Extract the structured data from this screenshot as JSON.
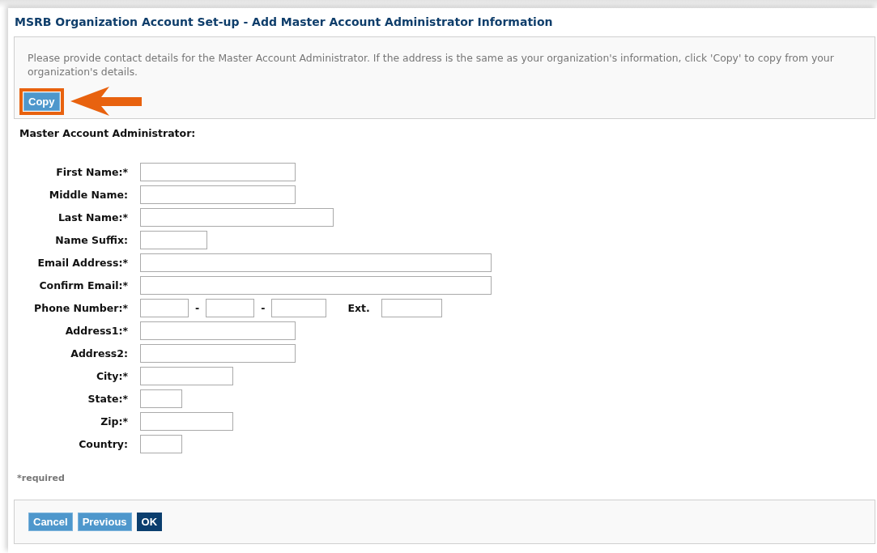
{
  "title": "MSRB Organization Account Set-up - Add Master Account Administrator Information",
  "instructions": {
    "text": "Please provide contact details for the Master Account Administrator. If the address is the same as your organization's information, click 'Copy' to copy from your organization's details.",
    "button": {
      "label": "Copy",
      "highlighted": true
    }
  },
  "section_title": "Master Account Administrator:",
  "fields": [
    {
      "kind": "text",
      "label": "First Name:*"
    },
    {
      "kind": "text",
      "label": "Middle Name:"
    },
    {
      "kind": "text",
      "label": "Last Name:*"
    },
    {
      "kind": "text",
      "label": "Name Suffix:"
    },
    {
      "kind": "text",
      "label": "Email Address:*"
    },
    {
      "kind": "text",
      "label": "Confirm Email:*"
    },
    {
      "kind": "phone",
      "label": "Phone Number:*",
      "separators": [
        "-",
        "-"
      ],
      "ext_label": "Ext."
    },
    {
      "kind": "text",
      "label": "Address1:*"
    },
    {
      "kind": "text",
      "label": "Address2:"
    },
    {
      "kind": "text",
      "label": "City:*"
    },
    {
      "kind": "text",
      "label": "State:*"
    },
    {
      "kind": "text",
      "label": "Zip:*"
    },
    {
      "kind": "text",
      "label": "Country:"
    }
  ],
  "required_note": "*required",
  "buttons": [
    {
      "label": "Cancel",
      "primary": false
    },
    {
      "label": "Previous",
      "primary": false
    },
    {
      "label": "OK",
      "primary": true
    }
  ]
}
